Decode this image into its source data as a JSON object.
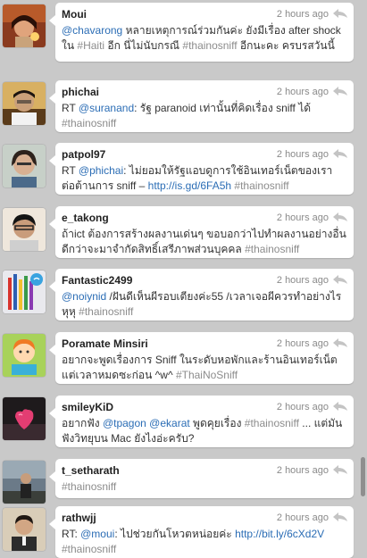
{
  "tweets": [
    {
      "user": "Moui",
      "time": "2 hours ago",
      "avatar_icon": "avatar-moui",
      "text": [
        {
          "t": "mention",
          "v": "@chavarong"
        },
        {
          "t": "plain",
          "v": " หลายเหตุการณ์ร่วมกันค่ะ ยังมีเรื่อง after shock ใน "
        },
        {
          "t": "hashtag",
          "v": "#Haiti"
        },
        {
          "t": "plain",
          "v": " อีก นี่ไม่นับกรณี "
        },
        {
          "t": "hashtag",
          "v": "#thainosniff"
        },
        {
          "t": "plain",
          "v": " อีกนะคะ ครบรสวันนี้"
        }
      ]
    },
    {
      "user": "phichai",
      "time": "2 hours ago",
      "avatar_icon": "avatar-phichai",
      "text": [
        {
          "t": "plain",
          "v": "RT "
        },
        {
          "t": "mention",
          "v": "@suranand"
        },
        {
          "t": "plain",
          "v": ": รัฐ paranoid เท่านั้นที่คิดเรื่อง sniff ได้ "
        },
        {
          "t": "hashtag",
          "v": "#thainosniff"
        }
      ]
    },
    {
      "user": "patpol97",
      "time": "2 hours ago",
      "avatar_icon": "avatar-patpol97",
      "text": [
        {
          "t": "plain",
          "v": "RT "
        },
        {
          "t": "mention",
          "v": "@phichai"
        },
        {
          "t": "plain",
          "v": ": ไม่ยอมให้รัฐแอบดูการใช้อินเทอร์เน็ตของเรา ต่อต้านการ sniff – "
        },
        {
          "t": "link",
          "v": "http://is.gd/6FA5h"
        },
        {
          "t": "plain",
          "v": " "
        },
        {
          "t": "hashtag",
          "v": "#thainosniff"
        }
      ]
    },
    {
      "user": "e_takong",
      "time": "2 hours ago",
      "avatar_icon": "avatar-e-takong",
      "text": [
        {
          "t": "plain",
          "v": "ถ้าict ต้องการสร้างผลงานเด่นๆ ขอบอกว่าไปทำผลงานอย่างอื่นดีกว่าจะมาจำกัดสิทธิ์เสรีภาพส่วนบุคคล "
        },
        {
          "t": "hashtag",
          "v": "#thainosniff"
        }
      ]
    },
    {
      "user": "Fantastic2499",
      "time": "2 hours ago",
      "avatar_icon": "avatar-fantastic2499",
      "text": [
        {
          "t": "mention",
          "v": "@noiynid"
        },
        {
          "t": "plain",
          "v": " /ฝันดีเห็นผีรอบเตียงค่ะ55 /เวลาเจอผีควรทำอย่างไร หุหุ  "
        },
        {
          "t": "hashtag",
          "v": "#thainosniff"
        }
      ]
    },
    {
      "user": "Poramate Minsiri",
      "time": "2 hours ago",
      "avatar_icon": "avatar-poramate",
      "text": [
        {
          "t": "plain",
          "v": "อยากจะพูดเรื่องการ Sniff ในระดับหอพักและร้านอินเทอร์เน็ตแต่เวลาหมดซะก่อน ^w^ "
        },
        {
          "t": "hashtag",
          "v": "#ThaiNoSniff"
        }
      ]
    },
    {
      "user": "smileyKiD",
      "time": "2 hours ago",
      "avatar_icon": "avatar-smileykid",
      "text": [
        {
          "t": "plain",
          "v": "อยากฟัง "
        },
        {
          "t": "mention",
          "v": "@tpagon"
        },
        {
          "t": "plain",
          "v": " "
        },
        {
          "t": "mention",
          "v": "@ekarat"
        },
        {
          "t": "plain",
          "v": " พูดคุยเรื่อง "
        },
        {
          "t": "hashtag",
          "v": "#thainosniff"
        },
        {
          "t": "plain",
          "v": " ... แต่มันฟังวิทยุบน Mac ยังไงอ่ะครับ?"
        }
      ]
    },
    {
      "user": "t_setharath",
      "time": "2 hours ago",
      "avatar_icon": "avatar-t-setharath",
      "text": [
        {
          "t": "hashtag",
          "v": "#thainosniff"
        }
      ]
    },
    {
      "user": "rathwjj",
      "time": "2 hours ago",
      "avatar_icon": "avatar-rathwjj",
      "text": [
        {
          "t": "plain",
          "v": "RT: "
        },
        {
          "t": "mention",
          "v": "@moui"
        },
        {
          "t": "plain",
          "v": ": ไปช่วยกันโหวตหน่อยค่ะ "
        },
        {
          "t": "link",
          "v": "http://bit.ly/6cXd2V"
        },
        {
          "t": "plain",
          "v": " "
        },
        {
          "t": "hashtag",
          "v": "#thainosniff"
        }
      ]
    }
  ],
  "icons": {
    "reply": "reply-arrow-icon"
  },
  "colors": {
    "background": "#c9c9c9",
    "bubble": "#ffffff",
    "mention": "#2b6db5",
    "hashtag": "#8c8c8c",
    "time": "#8a8a8a"
  }
}
